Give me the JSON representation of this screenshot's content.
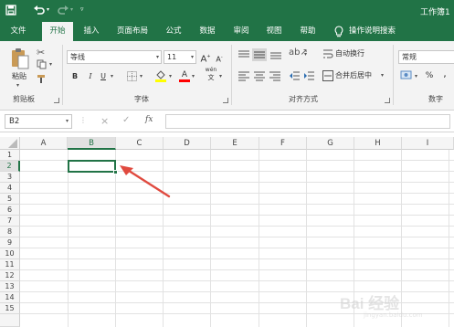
{
  "title_bar": {
    "workbook_name": "工作簿1",
    "save_icon": "save-icon",
    "undo_icon": "undo-icon",
    "redo_icon": "redo-icon",
    "customize_icon": "customize-qat-icon"
  },
  "tabs": [
    {
      "label": "文件"
    },
    {
      "label": "开始"
    },
    {
      "label": "插入"
    },
    {
      "label": "页面布局"
    },
    {
      "label": "公式"
    },
    {
      "label": "数据"
    },
    {
      "label": "审阅"
    },
    {
      "label": "视图"
    },
    {
      "label": "帮助"
    },
    {
      "label": "操作说明搜索"
    }
  ],
  "active_tab": "开始",
  "ribbon": {
    "clipboard": {
      "paste_label": "粘贴",
      "group_label": "剪贴板"
    },
    "font": {
      "font_name": "等线",
      "font_size": "11",
      "bold": "B",
      "italic": "I",
      "underline": "U",
      "grow": "A",
      "shrink": "A",
      "font_color_letter": "A",
      "phonetic": "wén",
      "group_label": "字体"
    },
    "alignment": {
      "wrap_text": "自动换行",
      "merge_center": "合并后居中",
      "group_label": "对齐方式"
    },
    "number": {
      "format": "常规",
      "percent": "%",
      "comma": ",",
      "group_label": "数字"
    }
  },
  "formula_bar": {
    "name_box": "B2",
    "fx": "fx",
    "cancel": "×",
    "enter": "✓",
    "content": ""
  },
  "grid": {
    "columns": [
      "A",
      "B",
      "C",
      "D",
      "E",
      "F",
      "G",
      "H",
      "I"
    ],
    "rows": [
      "1",
      "2",
      "3",
      "4",
      "5",
      "6",
      "7",
      "8",
      "9",
      "10",
      "11",
      "12",
      "13",
      "14",
      "15"
    ],
    "selected_cell": "B2"
  },
  "colors": {
    "accent": "#217346",
    "annotation_arrow": "#e04a3f"
  },
  "watermark": {
    "text": "Bai 经验",
    "url": "jingyan.baidu.com"
  }
}
